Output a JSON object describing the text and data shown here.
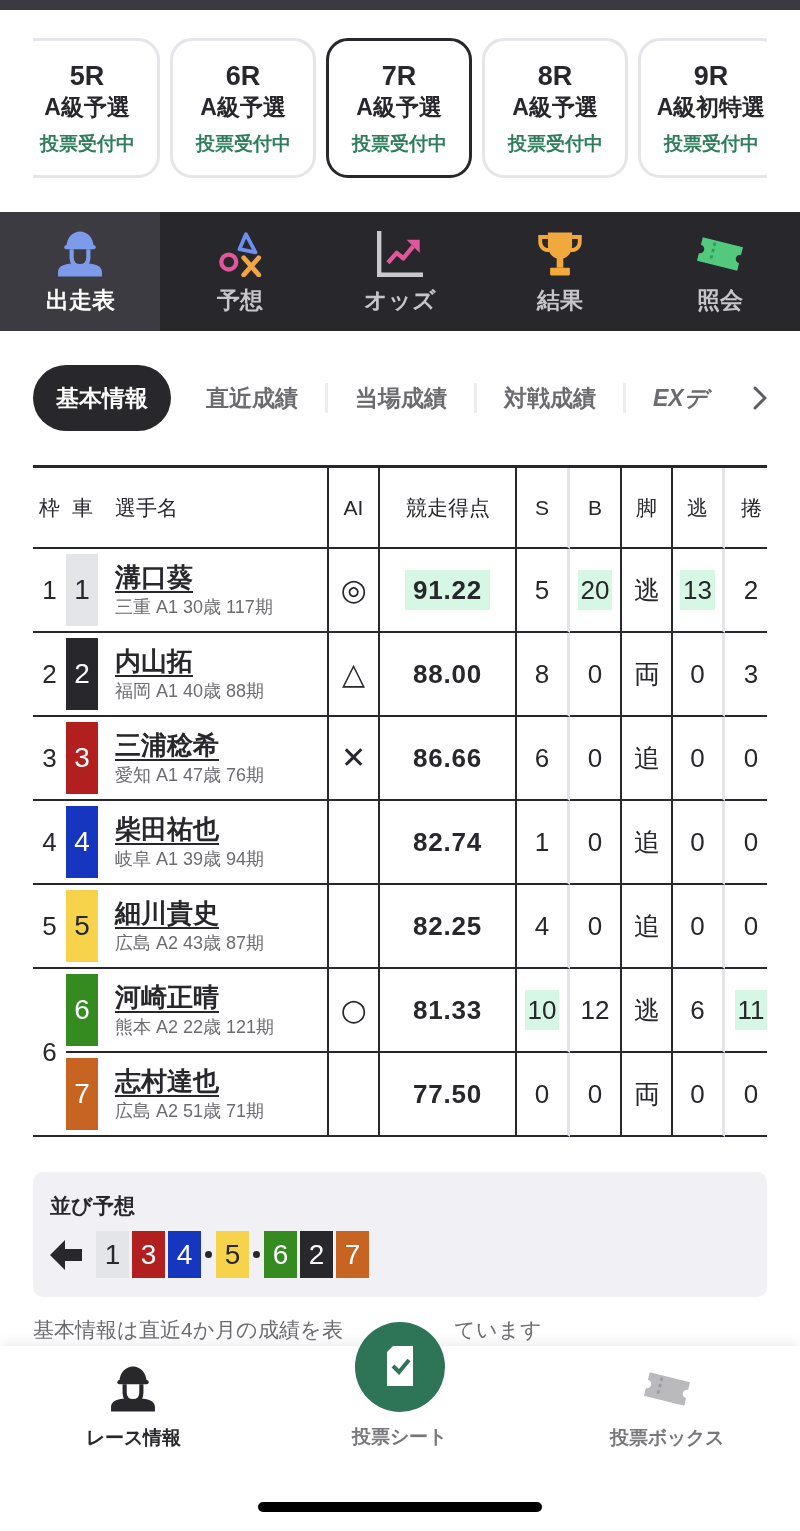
{
  "race_tabs": [
    {
      "race": "5R",
      "grade": "A級予選",
      "status": "投票受付中",
      "selected": false
    },
    {
      "race": "6R",
      "grade": "A級予選",
      "status": "投票受付中",
      "selected": false
    },
    {
      "race": "7R",
      "grade": "A級予選",
      "status": "投票受付中",
      "selected": true
    },
    {
      "race": "8R",
      "grade": "A級予選",
      "status": "投票受付中",
      "selected": false
    },
    {
      "race": "9R",
      "grade": "A級初特選",
      "status": "投票受付中",
      "selected": false
    }
  ],
  "nav_tabs": [
    {
      "label": "出走表",
      "kind": "entries",
      "selected": true
    },
    {
      "label": "予想",
      "kind": "forecast",
      "selected": false
    },
    {
      "label": "オッズ",
      "kind": "odds",
      "selected": false
    },
    {
      "label": "結果",
      "kind": "results",
      "selected": false
    },
    {
      "label": "照会",
      "kind": "inquiry",
      "selected": false
    }
  ],
  "info_tabs": [
    {
      "label": "基本情報",
      "kind": "text",
      "selected": true
    },
    {
      "label": "直近成績",
      "kind": "text",
      "selected": false
    },
    {
      "label": "当場成績",
      "kind": "text",
      "selected": false
    },
    {
      "label": "対戦成績",
      "kind": "text",
      "selected": false
    },
    {
      "label": "EXデ",
      "kind": "ex",
      "selected": false
    }
  ],
  "table": {
    "columns": [
      "枠",
      "車",
      "選手名",
      "AI",
      "競走得点",
      "S",
      "B",
      "脚",
      "逃",
      "捲"
    ],
    "frames": [
      {
        "frame": "1",
        "riders": [
          {
            "car": "1",
            "color": "#e4e5e9",
            "name": "溝口葵",
            "profile": "三重 A1 30歳 117期",
            "ai_mark": "◎",
            "stats": [
              {
                "text": "91.22",
                "highlight": true
              },
              {
                "text": "5",
                "highlight": false
              },
              {
                "text": "20",
                "highlight": true
              },
              {
                "text": "逃",
                "highlight": false
              },
              {
                "text": "13",
                "highlight": true
              },
              {
                "text": "2",
                "highlight": false
              }
            ]
          }
        ]
      },
      {
        "frame": "2",
        "riders": [
          {
            "car": "2",
            "color": "#27272c",
            "name": "内山拓",
            "profile": "福岡 A1 40歳 88期",
            "ai_mark": "△",
            "stats": [
              {
                "text": "88.00",
                "highlight": false
              },
              {
                "text": "8",
                "highlight": false
              },
              {
                "text": "0",
                "highlight": false
              },
              {
                "text": "両",
                "highlight": false
              },
              {
                "text": "0",
                "highlight": false
              },
              {
                "text": "3",
                "highlight": false
              }
            ]
          }
        ]
      },
      {
        "frame": "3",
        "riders": [
          {
            "car": "3",
            "color": "#b21f1f",
            "name": "三浦稔希",
            "profile": "愛知 A1 47歳 76期",
            "ai_mark": "✕",
            "stats": [
              {
                "text": "86.66",
                "highlight": false
              },
              {
                "text": "6",
                "highlight": false
              },
              {
                "text": "0",
                "highlight": false
              },
              {
                "text": "追",
                "highlight": false
              },
              {
                "text": "0",
                "highlight": false
              },
              {
                "text": "0",
                "highlight": false
              }
            ]
          }
        ]
      },
      {
        "frame": "4",
        "riders": [
          {
            "car": "4",
            "color": "#1636c0",
            "name": "柴田祐也",
            "profile": "岐阜 A1 39歳 94期",
            "stats": [
              {
                "text": "82.74",
                "highlight": false
              },
              {
                "text": "1",
                "highlight": false
              },
              {
                "text": "0",
                "highlight": false
              },
              {
                "text": "追",
                "highlight": false
              },
              {
                "text": "0",
                "highlight": false
              },
              {
                "text": "0",
                "highlight": false
              }
            ]
          }
        ]
      },
      {
        "frame": "5",
        "riders": [
          {
            "car": "5",
            "color": "#f7d24b",
            "name": "細川貴史",
            "profile": "広島 A2 43歳 87期",
            "stats": [
              {
                "text": "82.25",
                "highlight": false
              },
              {
                "text": "4",
                "highlight": false
              },
              {
                "text": "0",
                "highlight": false
              },
              {
                "text": "追",
                "highlight": false
              },
              {
                "text": "0",
                "highlight": false
              },
              {
                "text": "0",
                "highlight": false
              }
            ]
          }
        ]
      },
      {
        "frame": "6",
        "riders": [
          {
            "car": "6",
            "color": "#358a20",
            "name": "河崎正晴",
            "profile": "熊本 A2 22歳 121期",
            "ai_mark": "○",
            "stats": [
              {
                "text": "81.33",
                "highlight": false
              },
              {
                "text": "10",
                "highlight": true
              },
              {
                "text": "12",
                "highlight": false
              },
              {
                "text": "逃",
                "highlight": false
              },
              {
                "text": "6",
                "highlight": false
              },
              {
                "text": "11",
                "highlight": true
              }
            ]
          },
          {
            "car": "7",
            "color": "#c76421",
            "name": "志村達也",
            "profile": "広島 A2 51歳 71期",
            "stats": [
              {
                "text": "77.50",
                "highlight": false
              },
              {
                "text": "0",
                "highlight": false
              },
              {
                "text": "0",
                "highlight": false
              },
              {
                "text": "両",
                "highlight": false
              },
              {
                "text": "0",
                "highlight": false
              },
              {
                "text": "0",
                "highlight": false
              }
            ]
          }
        ]
      }
    ]
  },
  "line_prediction": {
    "title": "並び予想",
    "groups": [
      {
        "cars": [
          {
            "car": "1",
            "color": "#e4e5e9"
          },
          {
            "car": "3",
            "color": "#b21f1f"
          },
          {
            "car": "4",
            "color": "#1636c0"
          }
        ]
      },
      {
        "cars": [
          {
            "car": "5",
            "color": "#f7d24b"
          }
        ]
      },
      {
        "cars": [
          {
            "car": "6",
            "color": "#358a20"
          },
          {
            "car": "2",
            "color": "#27272c"
          },
          {
            "car": "7",
            "color": "#c76421"
          }
        ]
      }
    ]
  },
  "note_fragments": [
    "基本情報は直近4か月の成績を表",
    "ています"
  ],
  "bottom_nav": [
    {
      "label": "レース情報",
      "kind": "race_info",
      "selected": true
    },
    {
      "label": "投票シート",
      "kind": "bet_sheet",
      "selected": false
    },
    {
      "label": "投票ボックス",
      "kind": "bet_box",
      "selected": false
    }
  ]
}
